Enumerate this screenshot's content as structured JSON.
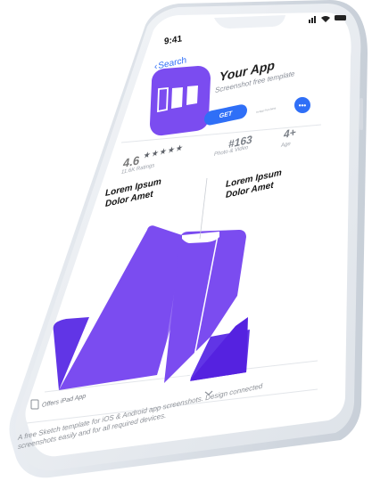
{
  "status": {
    "time": "9:41"
  },
  "nav": {
    "back_label": "Search"
  },
  "app": {
    "name": "Your App",
    "subtitle": "Screenshot free template",
    "get_label": "GET",
    "iap_note": "In-App Purchase",
    "more_label": "•••"
  },
  "stats": {
    "rating": "4.6",
    "stars": "★★★★★",
    "rating_count": "11.6K Ratings",
    "rank": "#163",
    "rank_label": "Photo & Video",
    "age": "4+",
    "age_label": "Age"
  },
  "screenshots": [
    {
      "title_line1": "Lorem Ipsum",
      "title_line2": "Dolor Amet"
    },
    {
      "title_line1": "Lorem Ipsum",
      "title_line2": "Dolor Amet"
    }
  ],
  "ipad": {
    "label": "Offers iPad App"
  },
  "description": "A free Sketch template for iOS & Android app screenshots. Design connected screenshots easily and for all required devices.",
  "colors": {
    "accent": "#7b4cf0",
    "blue": "#2f6ff7"
  }
}
